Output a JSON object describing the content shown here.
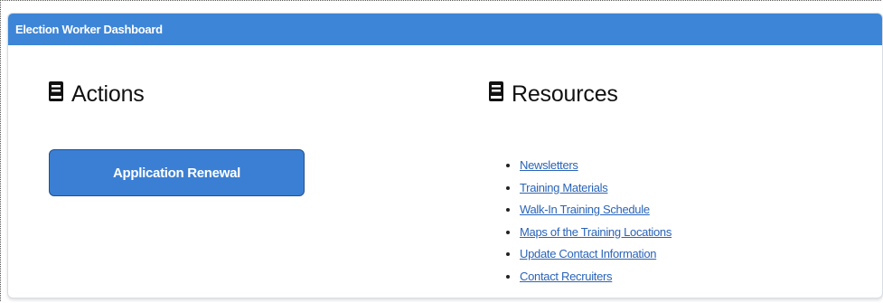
{
  "header": {
    "title": "Election Worker Dashboard"
  },
  "actions": {
    "title": "Actions",
    "icon": "book-icon",
    "renewal_button": "Application Renewal"
  },
  "resources": {
    "title": "Resources",
    "icon": "book-icon",
    "links": [
      {
        "label": "Newsletters"
      },
      {
        "label": "Training Materials"
      },
      {
        "label": "Walk-In Training Schedule"
      },
      {
        "label": "Maps of the Training Locations"
      },
      {
        "label": "Update Contact Information"
      },
      {
        "label": "Contact Recruiters"
      }
    ]
  },
  "colors": {
    "header_bg": "#3d85d7",
    "button_bg": "#3a7fd4",
    "link": "#2a64b8"
  }
}
